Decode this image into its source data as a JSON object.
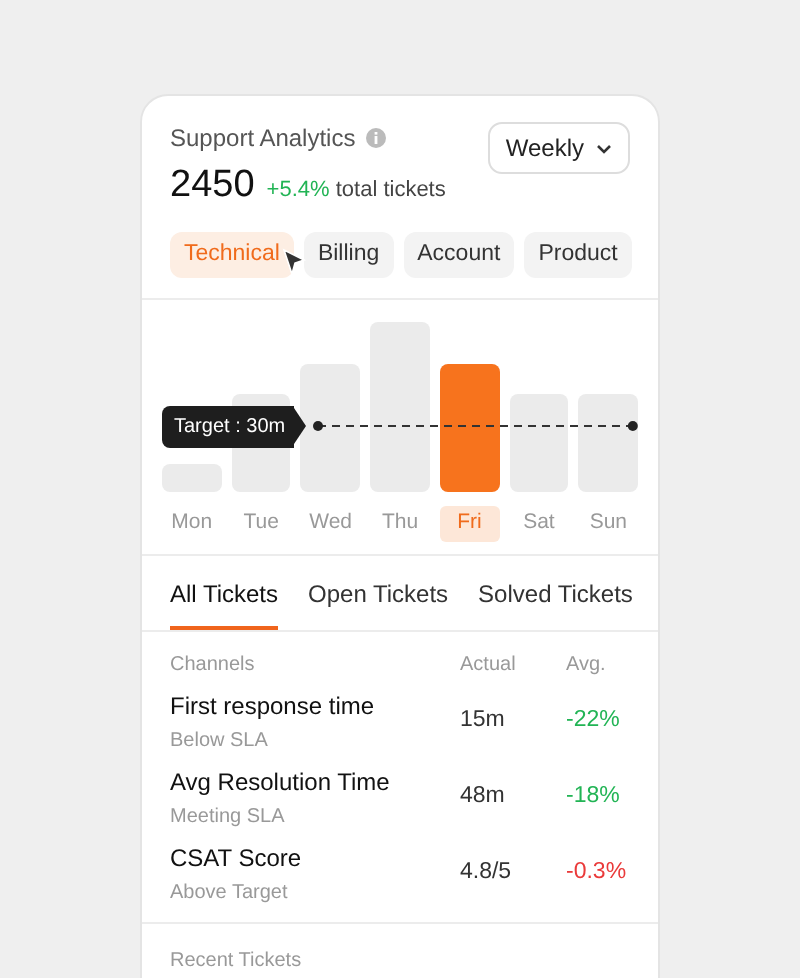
{
  "header": {
    "title": "Support Analytics",
    "period": "Weekly",
    "total": "2450",
    "change": "+5.4%",
    "change_label": "total tickets"
  },
  "categories": [
    {
      "label": "Technical",
      "selected": true
    },
    {
      "label": "Billing",
      "selected": false
    },
    {
      "label": "Account",
      "selected": false
    },
    {
      "label": "Product",
      "selected": false
    }
  ],
  "chart": {
    "target_label": "Target : 30m",
    "days": [
      {
        "label": "Mon",
        "selected": false
      },
      {
        "label": "Tue",
        "selected": false
      },
      {
        "label": "Wed",
        "selected": false
      },
      {
        "label": "Thu",
        "selected": false
      },
      {
        "label": "Fri",
        "selected": true
      },
      {
        "label": "Sat",
        "selected": false
      },
      {
        "label": "Sun",
        "selected": false
      }
    ]
  },
  "tabs": [
    {
      "label": "All Tickets",
      "selected": true
    },
    {
      "label": "Open Tickets",
      "selected": false
    },
    {
      "label": "Solved Tickets",
      "selected": false
    }
  ],
  "table": {
    "columns": [
      "Channels",
      "Actual",
      "Avg."
    ],
    "rows": [
      {
        "name": "First response time",
        "status": "Below SLA",
        "actual": "15m",
        "avg": "-22%",
        "color": "#22b455"
      },
      {
        "name": "Avg Resolution Time",
        "status": "Meeting SLA",
        "actual": "48m",
        "avg": "-18%",
        "color": "#22b455"
      },
      {
        "name": "CSAT Score",
        "status": "Above Target",
        "actual": "4.8/5",
        "avg": "-0.3%",
        "color": "#ea3a3a"
      }
    ]
  },
  "recent": {
    "title": "Recent Tickets"
  }
}
